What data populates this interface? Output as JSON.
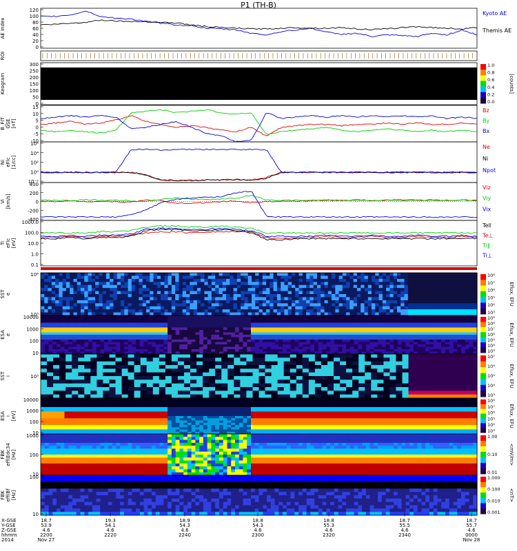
{
  "title": "P1 (TH-B)",
  "colors": {
    "red": "#e00000",
    "green": "#00d000",
    "blue": "#0000e0",
    "black": "#000000"
  },
  "panels": [
    {
      "id": "ae",
      "ylabel": [
        "AE Index"
      ],
      "yticks": [
        "120",
        "100",
        "80",
        "60",
        "40",
        "20",
        "0"
      ],
      "legend": [
        {
          "text": "Kyoto AE",
          "color": "blue"
        },
        {
          "text": "Themis AE",
          "color": "black"
        }
      ]
    },
    {
      "id": "roi",
      "ylabel": [
        "ROI"
      ],
      "yticks": []
    },
    {
      "id": "keogram",
      "ylabel": [
        "Keogram"
      ],
      "yticks": [
        "300",
        "250",
        "200",
        "150",
        "100",
        "50",
        "0"
      ],
      "colorbar": {
        "ticks": [
          "1.0",
          "0.8",
          "0.6",
          "0.4",
          "0.2",
          "0.0"
        ],
        "label": "[counts]"
      }
    },
    {
      "id": "b",
      "ylabel": [
        "B_FIT",
        "GSE",
        "[nT]"
      ],
      "yticks": [
        "15",
        "10",
        "5",
        "0",
        "-5",
        "-10"
      ],
      "legend": [
        {
          "text": "Bz",
          "color": "red"
        },
        {
          "text": "By",
          "color": "green"
        },
        {
          "text": "Bx",
          "color": "blue"
        }
      ]
    },
    {
      "id": "n",
      "ylabel": [
        "Ni",
        "eFlc",
        "[1/cc]"
      ],
      "yticks": [
        "10⁶",
        "10⁴",
        "10²",
        "10⁰",
        "10⁻²"
      ],
      "legend": [
        {
          "text": "Ne",
          "color": "red"
        },
        {
          "text": "Ni",
          "color": "black"
        },
        {
          "text": "Npot",
          "color": "blue"
        }
      ]
    },
    {
      "id": "v",
      "ylabel": [
        "Vi",
        "[km/s]"
      ],
      "yticks": [
        "400",
        "200",
        "0",
        "-200",
        "-400"
      ],
      "legend": [
        {
          "text": "Viz",
          "color": "red"
        },
        {
          "text": "Viy",
          "color": "green"
        },
        {
          "text": "Vix",
          "color": "blue"
        }
      ]
    },
    {
      "id": "t",
      "ylabel": [
        "Ti",
        "eFlc",
        "[eV]"
      ],
      "yticks": [
        "1000.0",
        "100.0",
        "10.0",
        "1.0",
        "0.1"
      ],
      "legend": [
        {
          "text": "Tell",
          "color": "black"
        },
        {
          "text": "Te⊥",
          "color": "red"
        },
        {
          "text": "Ti∥",
          "color": "green"
        },
        {
          "text": "Ti⊥",
          "color": "blue"
        }
      ]
    },
    {
      "id": "sste",
      "ylabel": [
        "SST",
        "e"
      ],
      "yticks": [
        "10⁶",
        "10⁵"
      ],
      "colorbar": {
        "ticks": [
          "10⁸",
          "10⁷",
          "10⁶",
          "10⁵",
          "10⁴",
          "10³"
        ],
        "label": "Eflux, EFU"
      }
    },
    {
      "id": "esae",
      "ylabel": [
        "ESA",
        "e"
      ],
      "yticks": [
        "10000",
        "1000",
        "100",
        "10"
      ],
      "colorbar": {
        "ticks": [
          "10⁹",
          "10⁸",
          "10⁷",
          "10⁶",
          "10⁵",
          "10⁴",
          "10³"
        ],
        "label": "Eflux, EFU"
      }
    },
    {
      "id": "ssti",
      "ylabel": [
        "SST",
        "i"
      ],
      "yticks": [
        "10⁵"
      ],
      "colorbar": {
        "ticks": [
          "10⁷",
          "10⁶",
          "10⁵",
          "10⁴",
          "10³"
        ],
        "label": "Eflux, EFU"
      }
    },
    {
      "id": "esai",
      "ylabel": [
        "ESA",
        "i",
        "[eV]"
      ],
      "yticks": [
        "10000",
        "1000",
        "100",
        "10"
      ],
      "colorbar": {
        "ticks": [
          "10⁸",
          "10⁷",
          "10⁶",
          "10⁵",
          "10⁴",
          "10³"
        ],
        "label": "Eflux, EFU"
      }
    },
    {
      "id": "fbke",
      "ylabel": [
        "FBK",
        "eff(Edc34",
        "[Hz]"
      ],
      "yticks": [
        "1000",
        "100",
        "10"
      ],
      "colorbar": {
        "ticks": [
          "1.00",
          "0.10",
          "0.01"
        ],
        "label": "<mV/m>"
      }
    },
    {
      "id": "fbkb",
      "ylabel": [
        "FBK",
        "eff(Bf",
        "[Hz]"
      ],
      "yticks": [
        "100",
        "10"
      ],
      "colorbar": {
        "ticks": [
          "1.000",
          "0.100",
          "0.010",
          "0.001"
        ],
        "label": "<nT>"
      }
    }
  ],
  "xaxis": {
    "rows": [
      {
        "label": "X-GSE",
        "values": [
          "18.7",
          "19.3",
          "18.9",
          "18.8",
          "18.8",
          "18.7",
          "18.7"
        ]
      },
      {
        "label": "Y-GSE",
        "values": [
          "53.9",
          "54.1",
          "54.3",
          "54.3",
          "55.3",
          "55.5",
          "55.7"
        ]
      },
      {
        "label": "Z-GSE",
        "values": [
          "4.6",
          "4.6",
          "4.6",
          "4.6",
          "4.6",
          "4.6",
          "4.6"
        ]
      },
      {
        "label": "hhmm",
        "values": [
          "2200",
          "2220",
          "2240",
          "2300",
          "2320",
          "2340",
          "0000"
        ]
      }
    ],
    "date_row": {
      "label": "2014",
      "start": "Nov 27",
      "end": "Nov 28"
    }
  },
  "chart_data": {
    "type": "line",
    "title": "P1 (TH-B)",
    "x_time": [
      "22:00",
      "22:20",
      "22:40",
      "23:00",
      "23:20",
      "23:40",
      "00:00"
    ],
    "ae": {
      "ylim": [
        0,
        120
      ],
      "series": [
        {
          "name": "Kyoto AE",
          "color": "blue",
          "values": [
            95,
            96,
            100,
            112,
            95,
            90,
            88,
            80,
            75,
            70,
            68,
            60,
            58,
            55,
            45,
            40,
            50,
            55,
            60,
            48,
            42,
            45,
            35,
            40,
            38,
            35,
            45,
            40,
            55,
            40
          ]
        },
        {
          "name": "Themis AE",
          "color": "black",
          "values": [
            70,
            72,
            75,
            78,
            85,
            82,
            80,
            80,
            78,
            76,
            70,
            65,
            62,
            60,
            58,
            58,
            60,
            62,
            60,
            60,
            62,
            58,
            56,
            58,
            62,
            65,
            62,
            60,
            58,
            62
          ]
        }
      ]
    },
    "b": {
      "ylim": [
        -10,
        15
      ],
      "series": [
        {
          "name": "Bz",
          "color": "red",
          "values": [
            2,
            3,
            4,
            2,
            3,
            5,
            8,
            4,
            2,
            0,
            1,
            0,
            -2,
            -3,
            0,
            -6,
            0,
            1,
            2,
            2,
            1,
            2,
            2,
            3,
            2,
            3,
            2,
            2,
            3,
            2
          ]
        },
        {
          "name": "By",
          "color": "green",
          "values": [
            -2,
            -3,
            -2,
            -3,
            -4,
            -2,
            10,
            11,
            12,
            10,
            11,
            12,
            10,
            9,
            10,
            -5,
            -3,
            -2,
            -1,
            0,
            -2,
            -3,
            -2,
            -1,
            -2,
            -3,
            -2,
            -3,
            -2,
            -3
          ]
        },
        {
          "name": "Bx",
          "color": "blue",
          "values": [
            6,
            7,
            8,
            7,
            8,
            7,
            -1,
            0,
            2,
            4,
            0,
            -4,
            -6,
            -10,
            -9,
            10,
            6,
            7,
            8,
            7,
            8,
            7,
            8,
            7,
            8,
            7,
            8,
            6,
            7,
            6
          ]
        }
      ]
    },
    "n": {
      "ylim_log10": [
        -2,
        6
      ],
      "series": [
        {
          "name": "Ne",
          "color": "red",
          "values_log10": [
            0,
            0,
            0,
            0,
            0,
            0,
            0,
            -0.5,
            -1.5,
            -1.6,
            -1.6,
            -1.5,
            -1.5,
            -1.4,
            -1.5,
            -1,
            0,
            0,
            0,
            0,
            0,
            0,
            0,
            0,
            0,
            0,
            0,
            0,
            0,
            0
          ]
        },
        {
          "name": "Ni",
          "color": "black",
          "values_log10": [
            0,
            0,
            0,
            0,
            0,
            0,
            0,
            -0.5,
            -1.5,
            -1.6,
            -1.6,
            -1.5,
            -1.5,
            -1.4,
            -1.6,
            -1.2,
            0,
            0,
            0,
            0,
            0,
            0,
            0,
            0,
            0,
            0,
            0,
            0,
            0,
            0
          ]
        },
        {
          "name": "Npot",
          "color": "blue",
          "values_log10": [
            0,
            0,
            0,
            0,
            0,
            0,
            4.5,
            4.5,
            4.4,
            4.5,
            4.5,
            4.5,
            4.5,
            4.5,
            4.5,
            4.5,
            0,
            0,
            0,
            0,
            0,
            0,
            0,
            0,
            0,
            0,
            0,
            0,
            0,
            0
          ]
        }
      ]
    },
    "v": {
      "ylim": [
        -450,
        450
      ],
      "series": [
        {
          "name": "Viz",
          "color": "red",
          "values": [
            0,
            5,
            10,
            0,
            5,
            0,
            -20,
            40,
            20,
            -50,
            -40,
            -30,
            0,
            10,
            -20,
            0,
            0,
            10,
            20,
            30,
            20,
            40,
            20,
            30,
            40,
            30,
            40,
            30,
            40,
            30
          ]
        },
        {
          "name": "Viy",
          "color": "green",
          "values": [
            20,
            30,
            20,
            40,
            30,
            30,
            20,
            0,
            50,
            80,
            60,
            40,
            60,
            80,
            150,
            40,
            20,
            30,
            20,
            20,
            30,
            20,
            20,
            30,
            20,
            30,
            20,
            20,
            30,
            20
          ]
        },
        {
          "name": "Vix",
          "color": "blue",
          "values": [
            -370,
            -370,
            -370,
            -370,
            -370,
            -370,
            -320,
            -200,
            -30,
            50,
            80,
            100,
            120,
            200,
            250,
            -350,
            -370,
            -370,
            -370,
            -370,
            -370,
            -370,
            -370,
            -370,
            -370,
            -370,
            -370,
            -370,
            -370,
            -370
          ]
        }
      ]
    },
    "t": {
      "ylim_log10": [
        -1,
        3
      ],
      "series": [
        {
          "name": "Te⊥",
          "color": "red",
          "values_log10": [
            1.5,
            1.5,
            1.6,
            1.5,
            1.6,
            1.6,
            1.7,
            1.9,
            2.0,
            2.0,
            1.9,
            2.0,
            2.0,
            2.0,
            1.9,
            1.5,
            1.4,
            1.5,
            1.5,
            1.6,
            1.5,
            1.5,
            1.6,
            1.5,
            1.5,
            1.6,
            1.5,
            1.5,
            1.6,
            1.5
          ]
        },
        {
          "name": "Ti∥",
          "color": "green",
          "values_log10": [
            1.9,
            1.9,
            1.9,
            1.9,
            2.0,
            2.0,
            2.1,
            2.4,
            2.5,
            2.5,
            2.4,
            2.4,
            2.5,
            2.4,
            2.3,
            1.9,
            1.9,
            1.9,
            1.9,
            1.9,
            1.9,
            1.9,
            1.9,
            1.9,
            1.9,
            1.9,
            1.9,
            1.9,
            1.9,
            1.9
          ]
        },
        {
          "name": "Ti⊥",
          "color": "blue",
          "values_log10": [
            1.6,
            1.6,
            1.7,
            1.6,
            1.7,
            1.7,
            1.8,
            2.2,
            2.3,
            2.3,
            2.2,
            2.2,
            2.3,
            2.2,
            2.1,
            1.6,
            1.6,
            1.6,
            1.6,
            1.7,
            1.6,
            1.6,
            1.7,
            1.6,
            1.6,
            1.7,
            1.6,
            1.6,
            1.7,
            1.6
          ]
        },
        {
          "name": "Tell",
          "color": "black",
          "values_log10": [
            1.4,
            1.4,
            1.5,
            1.4,
            1.5,
            1.5,
            1.6,
            2.1,
            2.2,
            2.2,
            2.1,
            2.1,
            2.2,
            2.1,
            2.0,
            1.3,
            1.3,
            1.4,
            1.4,
            1.4,
            1.4,
            1.4,
            1.4,
            1.4,
            1.4,
            1.4,
            1.4,
            1.4,
            1.4,
            1.4
          ]
        }
      ]
    }
  }
}
